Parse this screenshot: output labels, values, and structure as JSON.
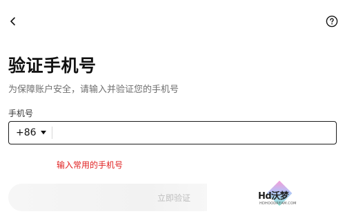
{
  "header": {
    "back_icon": "chevron-left-icon",
    "help_icon": "question-circle-icon"
  },
  "title": "验证手机号",
  "subtitle": "为保障账户安全，请输入并验证您的手机号",
  "phone_field": {
    "label": "手机号",
    "country_code": "+86",
    "value": "",
    "placeholder": ""
  },
  "error_message": "输入常用的手机号",
  "submit_label": "立即验证",
  "watermark": {
    "text": "Hd沃梦",
    "sub": "HDHOODREAM.COM"
  },
  "colors": {
    "error": "#e02020",
    "border": "#1a1a1a",
    "disabled_text": "#bdbdbd"
  }
}
